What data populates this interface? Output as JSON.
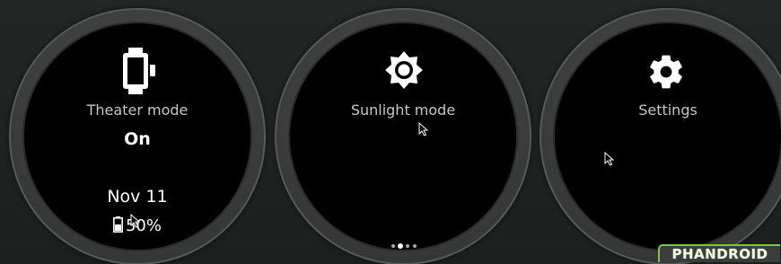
{
  "cards": [
    {
      "icon": "watch-icon",
      "title": "Theater mode",
      "value": "On",
      "date": "Nov 11",
      "battery_icon": "battery-icon",
      "battery": "50%"
    },
    {
      "icon": "brightness-icon",
      "title": "Sunlight mode"
    },
    {
      "icon": "settings-gear-icon",
      "title": "Settings"
    }
  ],
  "pager": {
    "pages": 4,
    "active_index": 1
  },
  "watermark": "PHANDROID",
  "colors": {
    "background": "#1d1f1e",
    "bezel": "#3b3e3d",
    "face": "#000000",
    "label": "#c7c7c7",
    "value": "#ffffff",
    "watermark_accent": "#82c341"
  }
}
